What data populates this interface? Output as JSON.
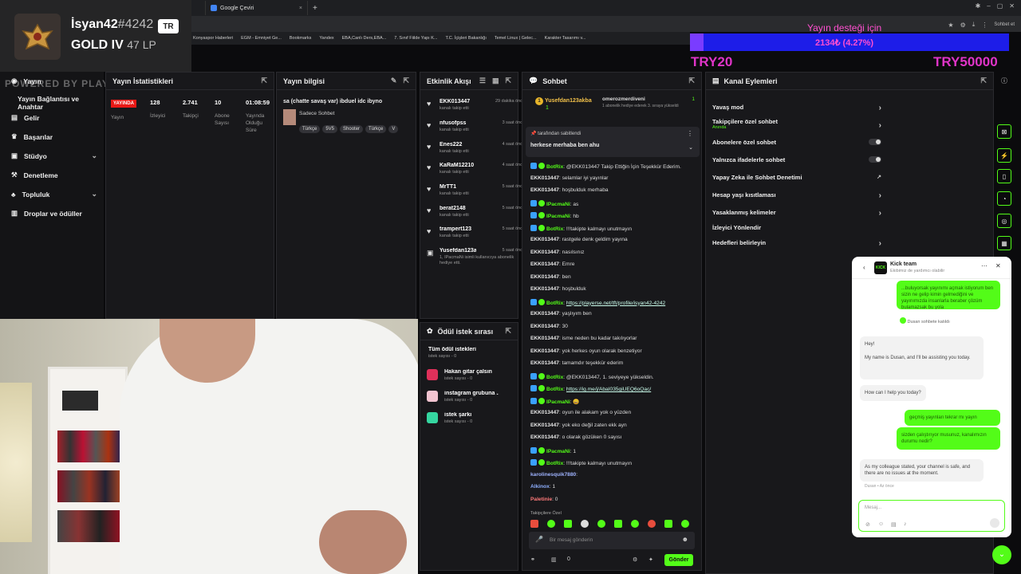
{
  "browser": {
    "tabs": [
      {
        "label": "Google Çeviri",
        "close": "×"
      }
    ],
    "new_tab": "+",
    "profile": "Sohbet et",
    "bookmarks": [
      "Konyaspor Haberleri",
      "EGM - Emniyet Ge...",
      "Bookmarks",
      "Yandex",
      "EBA,Canlı Ders,EBA...",
      "7. Sınıf Fiilde Yapı K...",
      "T.C. İçişleri Bakanlığı",
      "Temel Linux | Gelec...",
      "Karakter Tasarımı v..."
    ]
  },
  "donation_goal": {
    "title": "Yayın desteği için",
    "amount": "2134₺ (4.27%)",
    "min": "TRY20",
    "max": "TRY50000",
    "progress_percent": 4.27
  },
  "overlay": {
    "username": "İsyan42",
    "tag": "#4242",
    "region": "TR",
    "rank": "GOLD IV",
    "lp": "47 LP",
    "watermark": "POWERED BY PLAYERSE.NET/TFT"
  },
  "sidebar": {
    "items": [
      {
        "label": "Yayın",
        "icon": "broadcast-icon"
      },
      {
        "label": "Yayın Bağlantısı ve Anahtar",
        "icon": ""
      },
      {
        "label": "Gelir",
        "icon": "money-icon"
      },
      {
        "label": "Başarılar",
        "icon": "trophy-icon"
      },
      {
        "label": "Stüdyo",
        "icon": "studio-icon",
        "chevron": "⌄"
      },
      {
        "label": "Denetleme",
        "icon": "hammer-icon"
      },
      {
        "label": "Topluluk",
        "icon": "community-icon",
        "chevron": "⌄"
      },
      {
        "label": "Droplar ve ödüller",
        "icon": "gift-icon"
      }
    ]
  },
  "stats_panel": {
    "title": "Yayın İstatistikleri",
    "status_badge": "YAYINDA",
    "status_label": "Yayın",
    "stats": [
      {
        "value": "128",
        "label": "İzleyici"
      },
      {
        "value": "2.741",
        "label": "Takipçi"
      },
      {
        "value": "10",
        "label": "Abone Sayısı"
      },
      {
        "value": "01:08:59",
        "label": "Yayında Olduğu Süre"
      }
    ]
  },
  "info_panel": {
    "title": "Yayın bilgisi",
    "stream_title": "sa (chatte savaş var) ibduel idc ibyno",
    "category": "Sadece Sohbet",
    "tags": [
      "Türkçe",
      "5V5",
      "Shooter",
      "Türkçe",
      "V"
    ]
  },
  "activity_panel": {
    "title": "Etkinlik Akışı",
    "events": [
      {
        "name": "EKK013447",
        "sub": "kanalı takip etti",
        "time": "29 dakika önce"
      },
      {
        "name": "nfusofpss",
        "sub": "kanalı takip etti",
        "time": "3 saat önce"
      },
      {
        "name": "Enes222",
        "sub": "kanalı takip etti",
        "time": "4 saat önce"
      },
      {
        "name": "KaRaM12210",
        "sub": "kanalı takip etti",
        "time": "4 saat önce"
      },
      {
        "name": "MrTT1",
        "sub": "kanalı takip etti",
        "time": "5 saat önce"
      },
      {
        "name": "berat2148",
        "sub": "kanalı takip etti",
        "time": "5 saat önce"
      },
      {
        "name": "trampert123",
        "sub": "kanalı takip etti",
        "time": "5 saat önce"
      },
      {
        "name": "Yusefdan123akba",
        "sub": "1, IPacmaNi isimli kullanıcıya abonelik hediye etti.",
        "time": "5 saat önce"
      }
    ]
  },
  "rewards_panel": {
    "title": "Ödül istek sırası",
    "items": [
      {
        "name": "Tüm ödül istekleri",
        "sub": "istek sayısı - 0"
      },
      {
        "name": "Hakan gitar çalsın",
        "sub": "istek sayısı - 0"
      },
      {
        "name": "instagram grubuna ...",
        "sub": "istek sayısı - 0"
      },
      {
        "name": "istek şarkı",
        "sub": "istek sayısı - 0"
      }
    ]
  },
  "chat_panel": {
    "title": "Sohbet",
    "pinned_gifter": {
      "name": "Yusefdan123akba",
      "count": "1",
      "rank": "1"
    },
    "pinned_gifter2": {
      "name": "omerozmerdiveni",
      "count": "1",
      "sub": "1 abonelik hediye ederek 3. sıraya yükseldi"
    },
    "pinned_message": {
      "by": "tarafından sabitlendi",
      "text": "herkese merhaba ben ahu"
    },
    "messages": [
      {
        "user": "BotRix",
        "bot": true,
        "text": "@EKK013447 Takip Ettiğin İçin Teşekkür Ederim."
      },
      {
        "user": "EKK013447",
        "text": "selamlar iyi yayınlar"
      },
      {
        "user": "EKK013447",
        "text": "hoşbulduk merhaba"
      },
      {
        "user": "IPacmaNi",
        "bot": true,
        "text": "as"
      },
      {
        "user": "IPacmaNi",
        "bot": true,
        "text": "hb"
      },
      {
        "user": "BotRix",
        "bot": true,
        "text": "!!!takipte kalmayı unutmayın"
      },
      {
        "user": "EKK013447",
        "text": "rastgele denk geldim yayına"
      },
      {
        "user": "EKK013447",
        "text": "nasılsınız"
      },
      {
        "user": "EKK013447",
        "text": "Emre"
      },
      {
        "user": "EKK013447",
        "text": "ben"
      },
      {
        "user": "EKK013447",
        "text": "hoşbulduk"
      },
      {
        "user": "BotRix",
        "bot": true,
        "link": "https://playerse.net/tft/profile/isyan42-4242"
      },
      {
        "user": "EKK013447",
        "text": "yaşlıyım ben"
      },
      {
        "user": "EKK013447",
        "text": "30"
      },
      {
        "user": "EKK013447",
        "text": "isme neden bu kadar takılıyorlar"
      },
      {
        "user": "EKK013447",
        "text": "yok herkes oyun olarak benzetiyor"
      },
      {
        "user": "EKK013447",
        "text": "tamamdır teşekkür ederim"
      },
      {
        "user": "BotRix",
        "bot": true,
        "text": "@EKK013447, 1. seviyeye yükseldin."
      },
      {
        "user": "BotRix",
        "bot": true,
        "link": "https://ig.me/j/AbaI035giUEQ6oQac/"
      },
      {
        "user": "IPacmaNi",
        "bot": true,
        "text": "😄"
      },
      {
        "user": "EKK013447",
        "text": "oyun ile alakam yok o yüzden"
      },
      {
        "user": "EKK013447",
        "text": "yok eko değil zaten ekk ayn"
      },
      {
        "user": "EKK013447",
        "text": "o olarak gözüken 0 sayısı"
      },
      {
        "user": "IPacmaNi",
        "bot": true,
        "text": "1"
      },
      {
        "user": "BotRix",
        "bot": true,
        "text": "!!!takipte kalmayı unutmayın"
      },
      {
        "user": "karolinesquik7880",
        "text": ""
      },
      {
        "user": "Alkinox",
        "text": "1"
      },
      {
        "user": "Paletinie",
        "text": "0"
      }
    ],
    "emote_label": "Takipçilere Özel",
    "input_placeholder": "Bir mesaj gönderin",
    "send_label": "Gönder",
    "counter": "0"
  },
  "channel_panel": {
    "title": "Kanal Eylemleri",
    "rows": [
      {
        "label": "Yavaş mod",
        "sub": "",
        "control": "chevron"
      },
      {
        "label": "Takipçilere özel sohbet",
        "sub": "Anında",
        "control": "chevron"
      },
      {
        "label": "Abonelere özel sohbet",
        "sub": "",
        "control": "toggle"
      },
      {
        "label": "Yalnızca ifadelerle sohbet",
        "sub": "",
        "control": "toggle"
      },
      {
        "label": "Yapay Zeka ile Sohbet Denetimi",
        "sub": "",
        "control": "external"
      },
      {
        "label": "Hesap yaşı kısıtlaması",
        "sub": "",
        "control": "chevron"
      },
      {
        "label": "Yasaklanmış kelimeler",
        "sub": "",
        "control": "chevron"
      },
      {
        "label": "İzleyici Yönlendir",
        "sub": "",
        "control": "none"
      },
      {
        "label": "Hedefleri belirleyin",
        "sub": "",
        "control": "chevron"
      }
    ]
  },
  "support_widget": {
    "title": "Kick team",
    "subtitle": "Ekibimiz de yardımcı olabilir",
    "messages": [
      {
        "from": "user",
        "text": "...buluyorsak yayınımı açmak istiyorum ben sizin ne gelip kimin gelmediğini ve yayınımızda insanlarla beraber çözüm bulamazsak bu yola"
      },
      {
        "from": "system",
        "text": "Dusan sohbete katıldı"
      },
      {
        "from": "agent",
        "text": "Hey!"
      },
      {
        "from": "agent",
        "text": "My name is Dusan, and I'll be assisting you today."
      },
      {
        "from": "agent",
        "text": "How can I help you today?"
      },
      {
        "from": "user",
        "text": "geçmiş yayınları tekrar mı yayın"
      },
      {
        "from": "user",
        "text": "sizden çalıştırıyor musunuz, kanalımızın durumu nedir?"
      },
      {
        "from": "agent",
        "text": "As my colleague stated, your channel is safe, and there are no issues at the moment."
      },
      {
        "from": "meta",
        "text": "Dusan • Az önce"
      }
    ],
    "input_placeholder": "Mesaj..."
  },
  "colors": {
    "kick_green": "#53fc18",
    "panel_bg": "#18181b",
    "goal_pink": "#ff4fd0",
    "goal_blue": "#1d1de8",
    "live_red": "#e91916"
  }
}
